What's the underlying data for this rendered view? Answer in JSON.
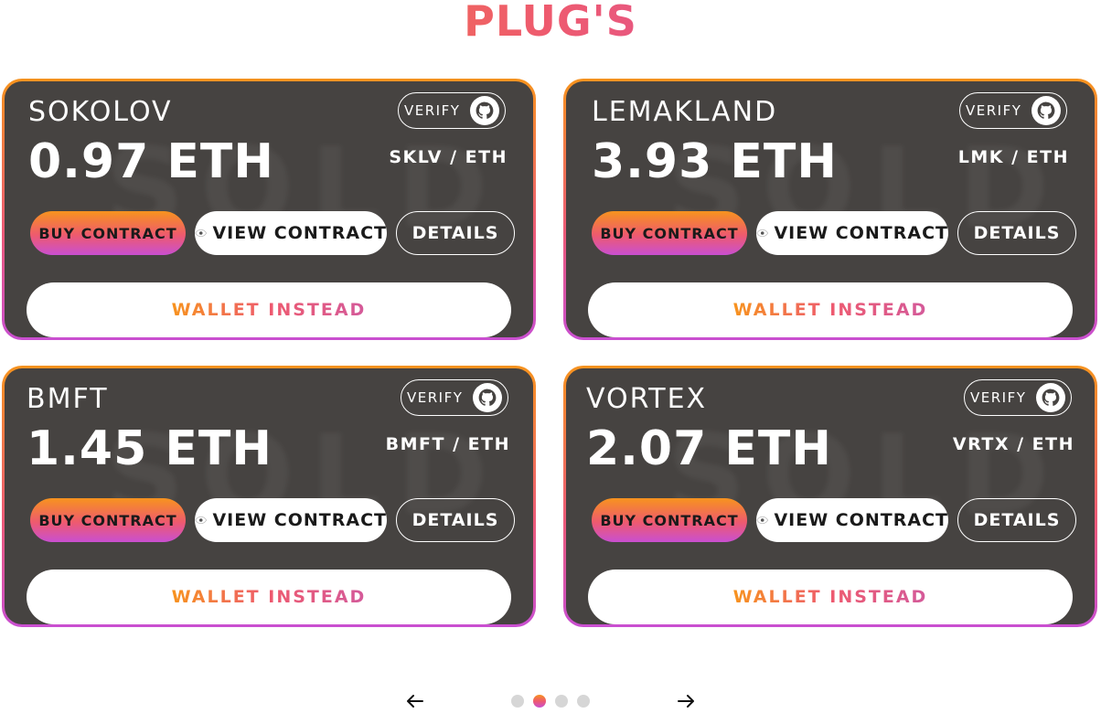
{
  "header": {
    "title": "PLUG'S"
  },
  "cards": [
    {
      "name": "SOKOLOV",
      "price": "0.97 ETH",
      "pair": "SKLV / ETH",
      "verify_label": "VERIFY",
      "buy_label": "BUY CONTRACT",
      "view_label": "VIEW CONTRACT",
      "details_label": "DETAILS",
      "wallet_label": "WALLET INSTEAD"
    },
    {
      "name": "LEMAKLAND",
      "price": "3.93 ETH",
      "pair": "LMK / ETH",
      "verify_label": "VERIFY",
      "buy_label": "BUY CONTRACT",
      "view_label": "VIEW CONTRACT",
      "details_label": "DETAILS",
      "wallet_label": "WALLET INSTEAD"
    },
    {
      "name": "BMFT",
      "price": "1.45 ETH",
      "pair": "BMFT / ETH",
      "verify_label": "VERIFY",
      "buy_label": "BUY CONTRACT",
      "view_label": "VIEW CONTRACT",
      "details_label": "DETAILS",
      "wallet_label": "WALLET INSTEAD"
    },
    {
      "name": "VORTEX",
      "price": "2.07 ETH",
      "pair": "VRTX / ETH",
      "verify_label": "VERIFY",
      "buy_label": "BUY CONTRACT",
      "view_label": "VIEW CONTRACT",
      "details_label": "DETAILS",
      "wallet_label": "WALLET INSTEAD"
    }
  ],
  "watermark_text": "SOLD",
  "pagination": {
    "total_pages": 4,
    "active_page": 2
  },
  "icons": {
    "verify": "github-icon",
    "view": "eye-icon",
    "prev": "arrow-left-icon",
    "next": "arrow-right-icon"
  },
  "colors": {
    "card_bg": "#464341",
    "gradient_start": "#f7931e",
    "gradient_mid": "#ee5a6f",
    "gradient_end": "#c94fd1",
    "dot_inactive": "#d6d6d6"
  }
}
